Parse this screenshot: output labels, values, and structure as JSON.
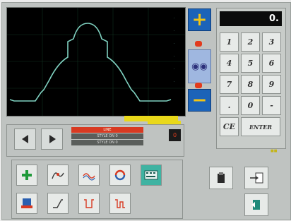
{
  "display": {
    "value": "0."
  },
  "keypad": {
    "keys": [
      "1",
      "2",
      "3",
      "4",
      "5",
      "6",
      "7",
      "8",
      "9",
      ".",
      "0",
      "-"
    ],
    "ce_label": "CE",
    "enter_label": "ENTER"
  },
  "zoom": {
    "plus_symbol": "+",
    "minus_symbol": "−"
  },
  "nav": {
    "bar1": "LINE",
    "bar2": "STYLE  ON  0",
    "bar3": "STYLE  ON  0",
    "block_symbol": "0"
  },
  "colors": {
    "graph_line": "#7fd1c0",
    "zoom_blue": "#1c63b8",
    "zoom_symbol": "#f2c414",
    "indicator_red": "#e23b1c",
    "highlight_yellow": "#e9d81a"
  },
  "icons": {
    "tools": [
      "add-icon",
      "curve-edit-icon",
      "wave-edit-icon",
      "refresh-icon",
      "keyboard-icon",
      "save-icon",
      "slope-icon",
      "pulse-icon",
      "pulse-alt-icon"
    ],
    "side": [
      "clipboard-icon",
      "import-icon",
      "exit-icon"
    ]
  }
}
